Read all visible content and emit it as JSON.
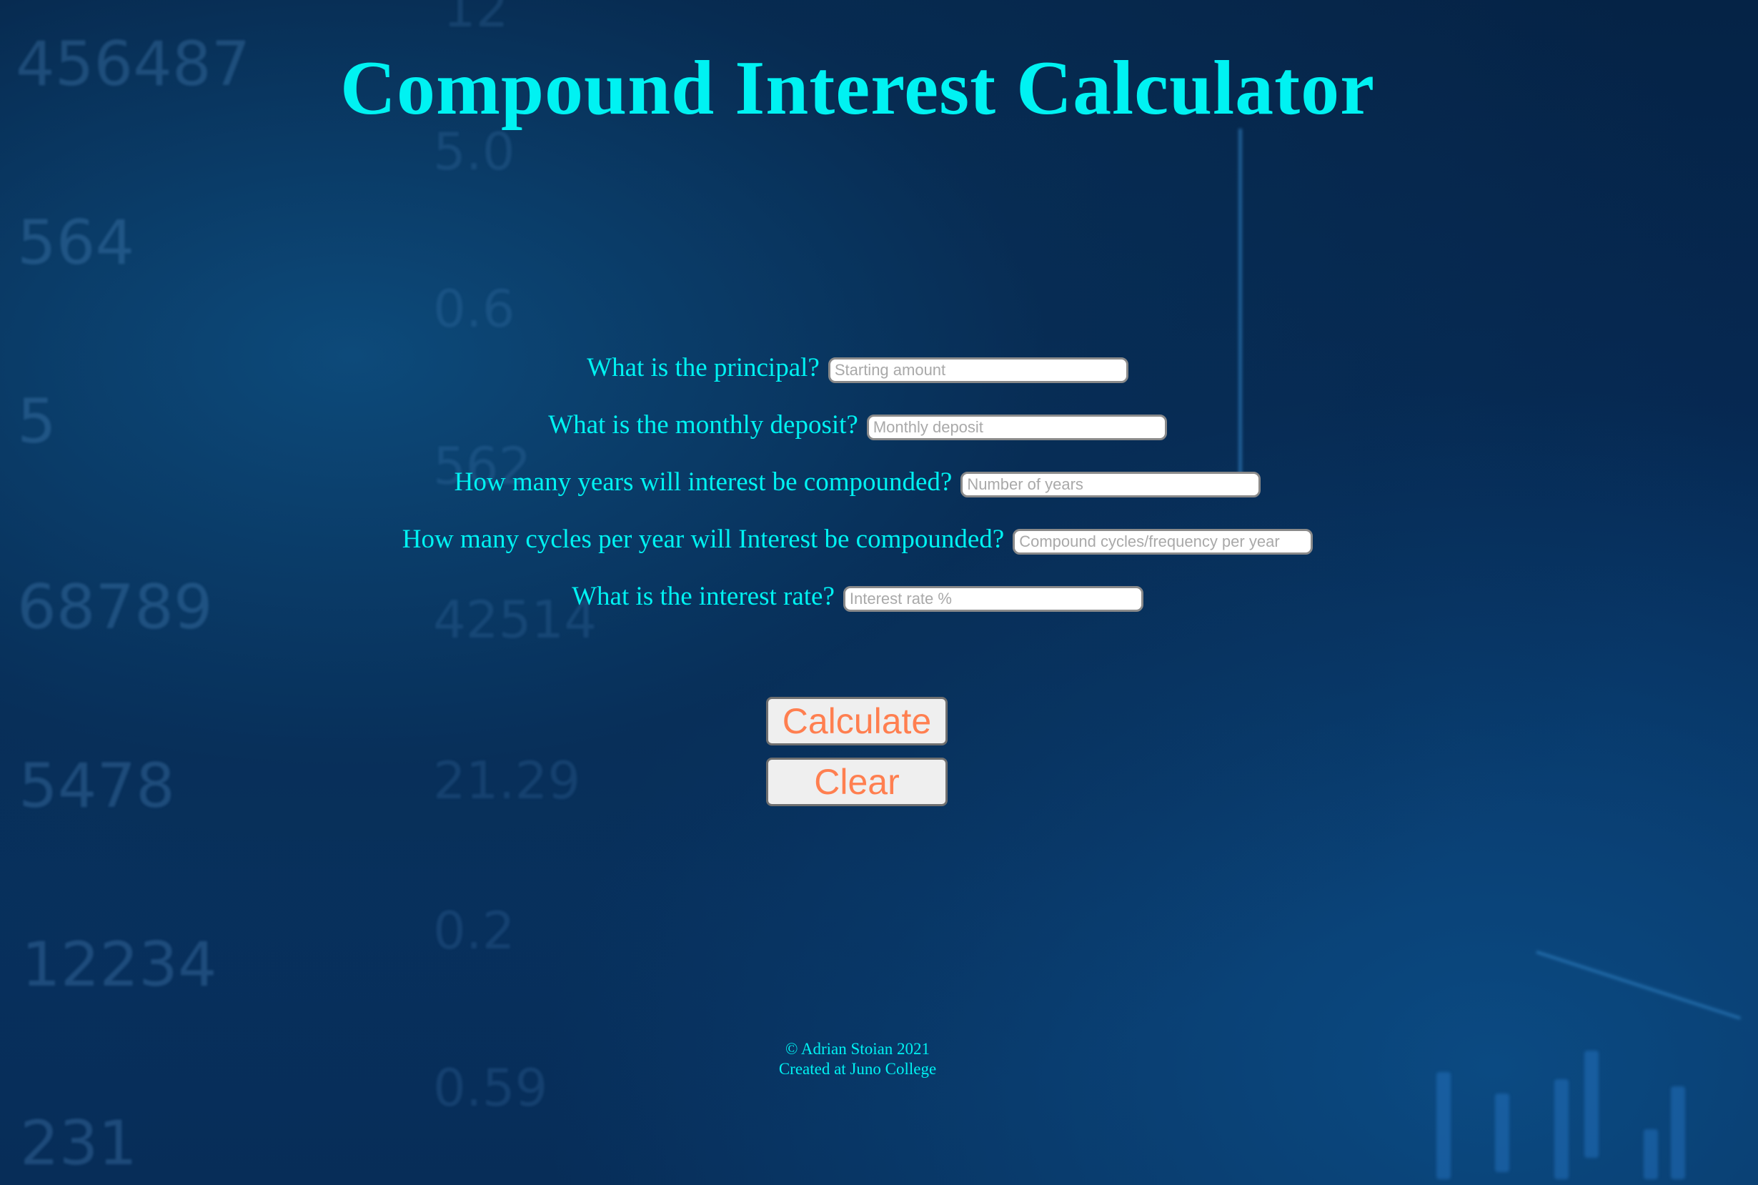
{
  "page": {
    "title": "Compound Interest Calculator"
  },
  "form": {
    "fields": [
      {
        "label": "What is the principal?",
        "placeholder": "Starting amount",
        "value": ""
      },
      {
        "label": "What is the monthly deposit?",
        "placeholder": "Monthly deposit",
        "value": ""
      },
      {
        "label": "How many years will interest be compounded?",
        "placeholder": "Number of years",
        "value": ""
      },
      {
        "label": "How many cycles per year will Interest be compounded?",
        "placeholder": "Compound cycles/frequency per year",
        "value": ""
      },
      {
        "label": "What is the interest rate?",
        "placeholder": "Interest rate %",
        "value": ""
      }
    ]
  },
  "actions": {
    "calculate_label": "Calculate",
    "clear_label": "Clear"
  },
  "footer": {
    "copyright": "© Adrian Stoian 2021",
    "credit": "Created at Juno College"
  },
  "background": {
    "numbers": [
      "456487",
      "564",
      "5",
      "68789",
      "5478",
      "12234",
      "231",
      "5.0",
      "0.6",
      "562",
      "42514",
      "21.29",
      "0.2",
      "0.59",
      "12"
    ]
  },
  "colors": {
    "accent_text": "#00f2f2",
    "button_text": "#ff7f50",
    "background_dark": "#052346"
  }
}
